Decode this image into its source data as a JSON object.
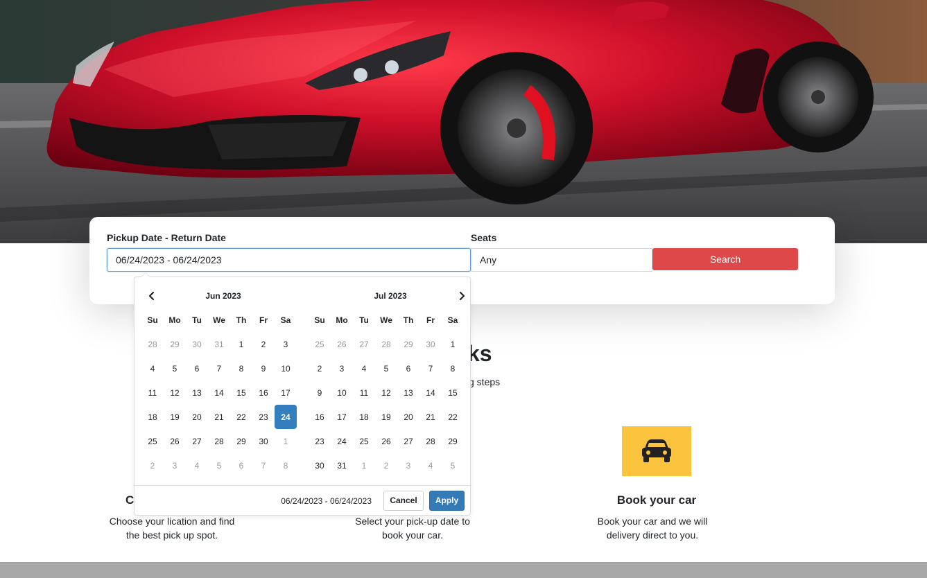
{
  "search": {
    "date_label": "Pickup Date - Return Date",
    "date_value": "06/24/2023 - 06/24/2023",
    "seats_label": "Seats",
    "seats_value": "Any",
    "search_button": "Search"
  },
  "section": {
    "title_visible": "ks",
    "subtitle_visible": "g steps"
  },
  "steps": [
    {
      "title_visible": "C",
      "desc_line1": "Choose your lication and find",
      "desc_line2": "the best pick up spot."
    },
    {
      "title_visible": "",
      "desc_line1": "Select your pick-up date to",
      "desc_line2": "book your car."
    },
    {
      "title": "Book your car",
      "desc_line1": "Book your car and we will",
      "desc_line2": "delivery direct to you.",
      "icon": "car-icon"
    }
  ],
  "picker": {
    "prev_icon": "chevron-left-icon",
    "next_icon": "chevron-right-icon",
    "weekdays": [
      "Su",
      "Mo",
      "Tu",
      "We",
      "Th",
      "Fr",
      "Sa"
    ],
    "months": [
      {
        "name": "Jun 2023",
        "days": [
          [
            "28",
            "29",
            "30",
            "31",
            "1",
            "2",
            "3"
          ],
          [
            "4",
            "5",
            "6",
            "7",
            "8",
            "9",
            "10"
          ],
          [
            "11",
            "12",
            "13",
            "14",
            "15",
            "16",
            "17"
          ],
          [
            "18",
            "19",
            "20",
            "21",
            "22",
            "23",
            "24"
          ],
          [
            "25",
            "26",
            "27",
            "28",
            "29",
            "30",
            "1"
          ],
          [
            "2",
            "3",
            "4",
            "5",
            "6",
            "7",
            "8"
          ]
        ],
        "off_days": [
          [
            0,
            0
          ],
          [
            0,
            1
          ],
          [
            0,
            2
          ],
          [
            0,
            3
          ],
          [
            4,
            6
          ],
          [
            5,
            0
          ],
          [
            5,
            1
          ],
          [
            5,
            2
          ],
          [
            5,
            3
          ],
          [
            5,
            4
          ],
          [
            5,
            5
          ],
          [
            5,
            6
          ]
        ],
        "selected": [
          3,
          6
        ]
      },
      {
        "name": "Jul 2023",
        "days": [
          [
            "25",
            "26",
            "27",
            "28",
            "29",
            "30",
            "1"
          ],
          [
            "2",
            "3",
            "4",
            "5",
            "6",
            "7",
            "8"
          ],
          [
            "9",
            "10",
            "11",
            "12",
            "13",
            "14",
            "15"
          ],
          [
            "16",
            "17",
            "18",
            "19",
            "20",
            "21",
            "22"
          ],
          [
            "23",
            "24",
            "25",
            "26",
            "27",
            "28",
            "29"
          ],
          [
            "30",
            "31",
            "1",
            "2",
            "3",
            "4",
            "5"
          ]
        ],
        "off_days": [
          [
            0,
            0
          ],
          [
            0,
            1
          ],
          [
            0,
            2
          ],
          [
            0,
            3
          ],
          [
            0,
            4
          ],
          [
            0,
            5
          ],
          [
            5,
            2
          ],
          [
            5,
            3
          ],
          [
            5,
            4
          ],
          [
            5,
            5
          ],
          [
            5,
            6
          ]
        ],
        "selected": null
      }
    ],
    "range_text": "06/24/2023 - 06/24/2023",
    "cancel_label": "Cancel",
    "apply_label": "Apply"
  },
  "colors": {
    "search_button": "#df4848",
    "step_icon_bg": "#fcc43e",
    "selected_day": "#357ebd",
    "apply_button": "#337ab7"
  }
}
